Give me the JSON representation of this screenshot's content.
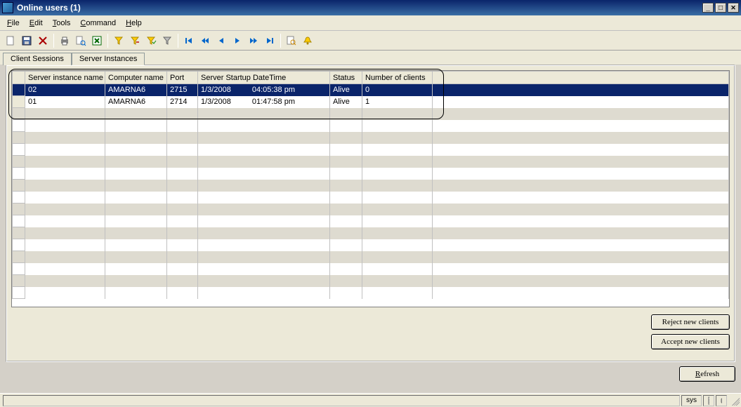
{
  "title": "Online users (1)",
  "menu": {
    "file": "File",
    "edit": "Edit",
    "tools": "Tools",
    "command": "Command",
    "help": "Help"
  },
  "tabs": {
    "client": "Client Sessions",
    "server": "Server Instances"
  },
  "columns": {
    "instance": "Server instance name",
    "computer": "Computer name",
    "port": "Port",
    "startup": "Server Startup DateTime",
    "status": "Status",
    "clients": "Number of clients"
  },
  "rows": [
    {
      "instance": "02",
      "computer": "AMARNA6",
      "port": "2715",
      "date": "1/3/2008",
      "time": "04:05:38 pm",
      "status": "Alive",
      "clients": "0",
      "selected": true
    },
    {
      "instance": "01",
      "computer": "AMARNA6",
      "port": "2714",
      "date": "1/3/2008",
      "time": "01:47:58 pm",
      "status": "Alive",
      "clients": "1",
      "selected": false
    }
  ],
  "buttons": {
    "reject": "Reject new clients",
    "accept": "Accept new clients",
    "refresh": "Refresh"
  },
  "status": {
    "sys": "sys"
  }
}
